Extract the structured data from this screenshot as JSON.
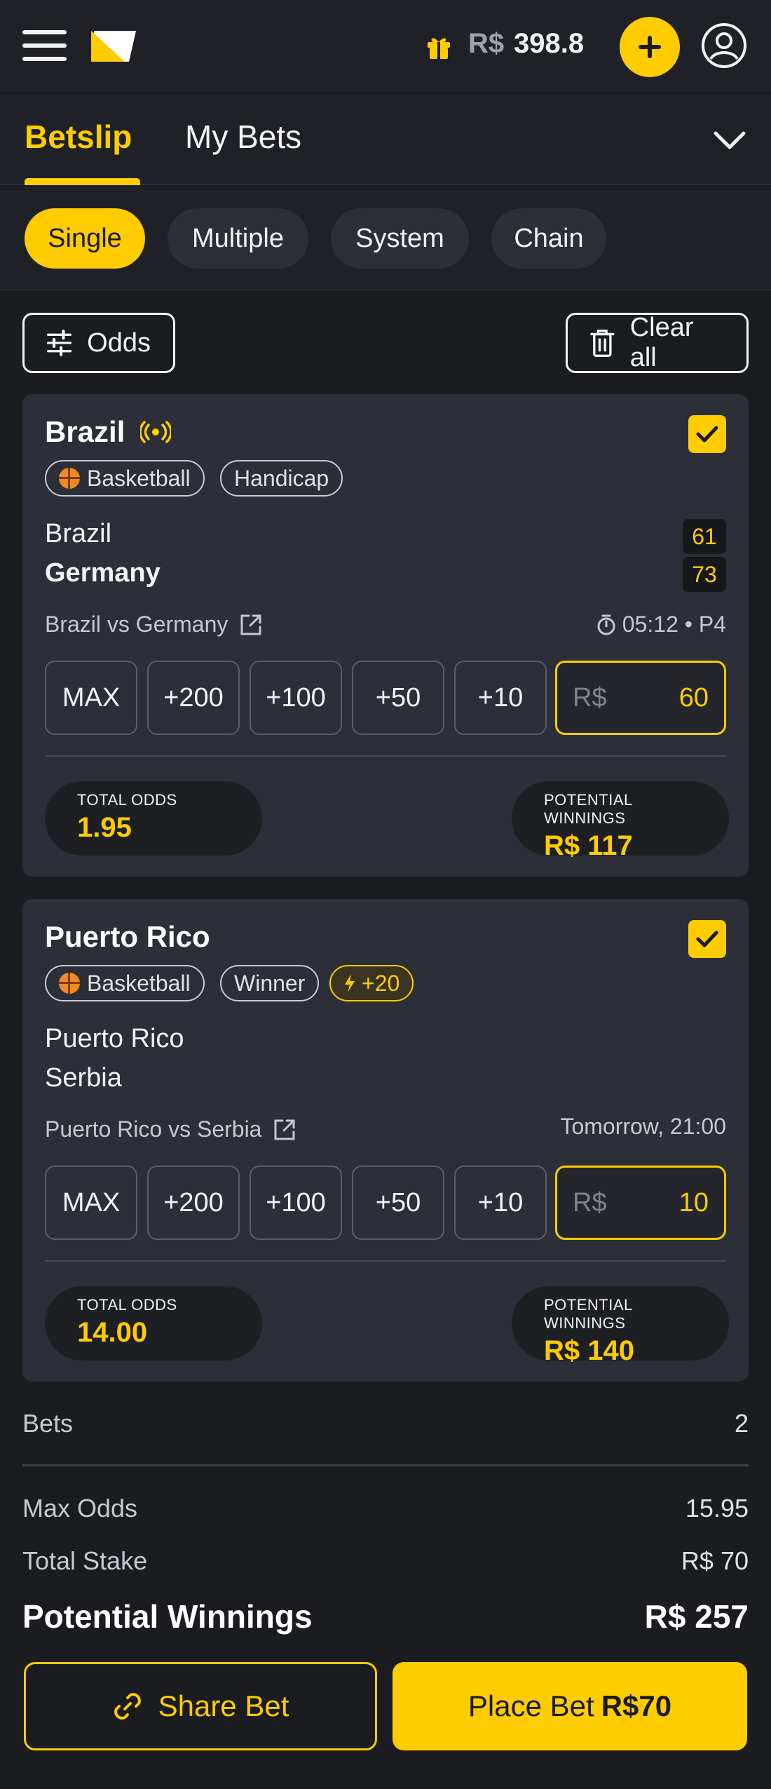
{
  "header": {
    "balance_currency": "R$",
    "balance_value": "398.8"
  },
  "tabs": [
    {
      "label": "Betslip",
      "active": true
    },
    {
      "label": "My Bets",
      "active": false
    }
  ],
  "bet_types": [
    {
      "label": "Single",
      "active": true
    },
    {
      "label": "Multiple",
      "active": false
    },
    {
      "label": "System",
      "active": false
    },
    {
      "label": "Chain",
      "active": false
    }
  ],
  "toolbar": {
    "odds_label": "Odds",
    "clear_label": "Clear all"
  },
  "bets": [
    {
      "title": "Brazil",
      "live": true,
      "checked": true,
      "tags": [
        "Basketball",
        "Handicap"
      ],
      "teams": [
        {
          "name": "Brazil",
          "score": "61",
          "bold": false
        },
        {
          "name": "Germany",
          "score": "73",
          "bold": true
        }
      ],
      "event": "Brazil vs Germany",
      "time": "05:12 • P4",
      "quick_stakes": [
        "MAX",
        "+200",
        "+100",
        "+50",
        "+10"
      ],
      "stake_currency": "R$",
      "stake_value": "60",
      "total_odds_label": "TOTAL ODDS",
      "total_odds": "1.95",
      "potential_label": "POTENTIAL WINNINGS",
      "potential": "R$ 117"
    },
    {
      "title": "Puerto Rico",
      "live": false,
      "checked": true,
      "tags": [
        "Basketball",
        "Winner"
      ],
      "boost": "+20",
      "teams": [
        {
          "name": "Puerto Rico"
        },
        {
          "name": "Serbia"
        }
      ],
      "event": "Puerto Rico vs Serbia",
      "time": "Tomorrow, 21:00",
      "quick_stakes": [
        "MAX",
        "+200",
        "+100",
        "+50",
        "+10"
      ],
      "stake_currency": "R$",
      "stake_value": "10",
      "total_odds_label": "TOTAL ODDS",
      "total_odds": "14.00",
      "potential_label": "POTENTIAL WINNINGS",
      "potential": "R$ 140"
    }
  ],
  "summary": {
    "bets_label": "Bets",
    "bets_value": "2",
    "max_odds_label": "Max Odds",
    "max_odds_value": "15.95",
    "total_stake_label": "Total Stake",
    "total_stake_value": "R$ 70",
    "potential_label": "Potential Winnings",
    "potential_value": "R$ 257"
  },
  "actions": {
    "share_label": "Share Bet",
    "place_label": "Place Bet",
    "place_amount": "R$70"
  },
  "colors": {
    "accent": "#ffcc00",
    "background": "#1a1c20",
    "card": "#2c2f37"
  }
}
